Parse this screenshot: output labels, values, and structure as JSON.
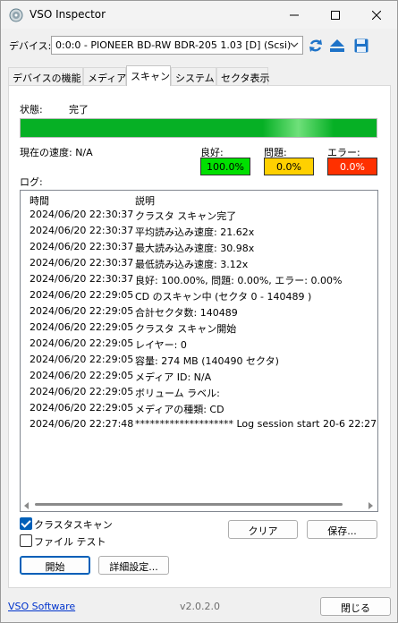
{
  "window": {
    "title": "VSO Inspector",
    "icon": "disc-icon"
  },
  "device": {
    "label": "デバイス:",
    "selected": "0:0:0 - PIONEER BD-RW   BDR-205 1.03 [D] (Scsi)"
  },
  "tabs": [
    {
      "label": "デバイスの機能",
      "active": false
    },
    {
      "label": "メディア",
      "active": false
    },
    {
      "label": "スキャン",
      "active": true
    },
    {
      "label": "システム",
      "active": false
    },
    {
      "label": "セクタ表示",
      "active": false
    }
  ],
  "scan": {
    "status_label": "状態:",
    "status_value": "完了",
    "progress": 1.0,
    "speed_label": "現在の速度: N/A",
    "good_label": "良好:",
    "good_value": "100.0%",
    "problem_label": "問題:",
    "problem_value": "0.0%",
    "error_label": "エラー:",
    "error_value": "0.0%",
    "colors": {
      "good": "#00e000",
      "problem": "#ffd000",
      "error": "#ff3000",
      "progress": "#06b025"
    }
  },
  "log": {
    "label": "ログ:",
    "col_time": "時間",
    "col_desc": "説明",
    "rows": [
      {
        "time": "2024/06/20 22:30:37",
        "desc": "クラスタ スキャン完了"
      },
      {
        "time": "2024/06/20 22:30:37",
        "desc": "平均読み込み速度: 21.62x"
      },
      {
        "time": "2024/06/20 22:30:37",
        "desc": "最大読み込み速度: 30.98x"
      },
      {
        "time": "2024/06/20 22:30:37",
        "desc": "最低読み込み速度: 3.12x"
      },
      {
        "time": "2024/06/20 22:30:37",
        "desc": "良好: 100.00%, 問題: 0.00%, エラー: 0.00%"
      },
      {
        "time": "2024/06/20 22:29:05",
        "desc": "CD のスキャン中 (セクタ 0 - 140489 )"
      },
      {
        "time": "2024/06/20 22:29:05",
        "desc": "合計セクタ数: 140489"
      },
      {
        "time": "2024/06/20 22:29:05",
        "desc": "クラスタ スキャン開始"
      },
      {
        "time": "2024/06/20 22:29:05",
        "desc": "レイヤー: 0"
      },
      {
        "time": "2024/06/20 22:29:05",
        "desc": "容量: 274 MB (140490 セクタ)"
      },
      {
        "time": "2024/06/20 22:29:05",
        "desc": "メディア ID: N/A"
      },
      {
        "time": "2024/06/20 22:29:05",
        "desc": "ボリューム ラベル:"
      },
      {
        "time": "2024/06/20 22:29:05",
        "desc": "メディアの種類: CD"
      },
      {
        "time": "2024/06/20 22:27:48",
        "desc": "******************** Log session start 20-6 22:27:4"
      }
    ]
  },
  "options": {
    "cluster_scan": {
      "label": "クラスタスキャン",
      "checked": true
    },
    "file_test": {
      "label": "ファイル テスト",
      "checked": false
    }
  },
  "buttons": {
    "clear": "クリア",
    "save": "保存...",
    "start": "開始",
    "advanced": "詳細設定...",
    "close": "閉じる"
  },
  "footer": {
    "link": "VSO Software",
    "version": "v2.0.2.0"
  }
}
